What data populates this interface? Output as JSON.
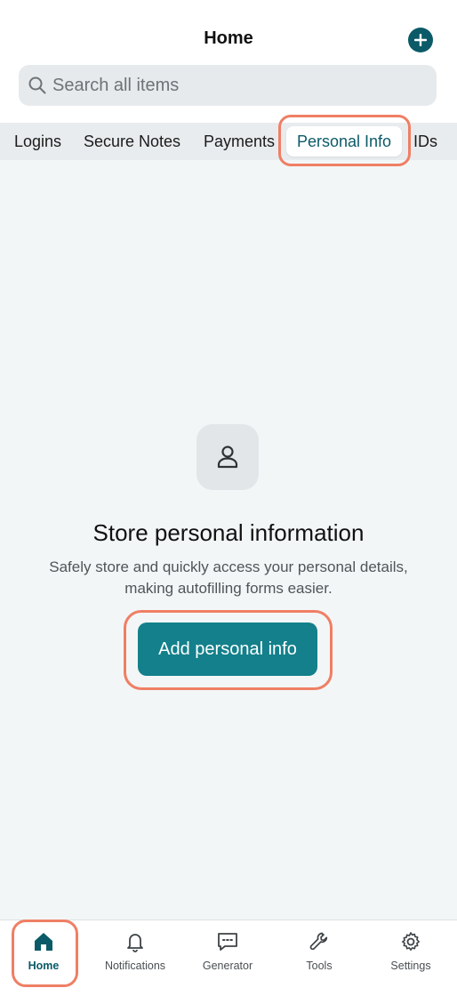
{
  "header": {
    "title": "Home",
    "add_icon": "plus-circle-icon"
  },
  "search": {
    "placeholder": "Search all items",
    "icon": "search-icon"
  },
  "tabs": [
    {
      "label": "Logins",
      "active": false
    },
    {
      "label": "Secure Notes",
      "active": false
    },
    {
      "label": "Payments",
      "active": false
    },
    {
      "label": "Personal Info",
      "active": true
    },
    {
      "label": "IDs",
      "active": false
    }
  ],
  "empty_state": {
    "icon": "person-icon",
    "title": "Store personal information",
    "description": "Safely store and quickly access your personal details, making autofilling forms easier.",
    "button_label": "Add personal info"
  },
  "bottom_nav": [
    {
      "label": "Home",
      "icon": "home-icon",
      "active": true
    },
    {
      "label": "Notifications",
      "icon": "bell-icon",
      "active": false
    },
    {
      "label": "Generator",
      "icon": "chat-icon",
      "active": false
    },
    {
      "label": "Tools",
      "icon": "wrench-icon",
      "active": false
    },
    {
      "label": "Settings",
      "icon": "gear-icon",
      "active": false
    }
  ],
  "colors": {
    "brand": "#0b5a68",
    "button": "#13808b",
    "highlight": "#ef7f64",
    "background": "#f3f6f7"
  }
}
